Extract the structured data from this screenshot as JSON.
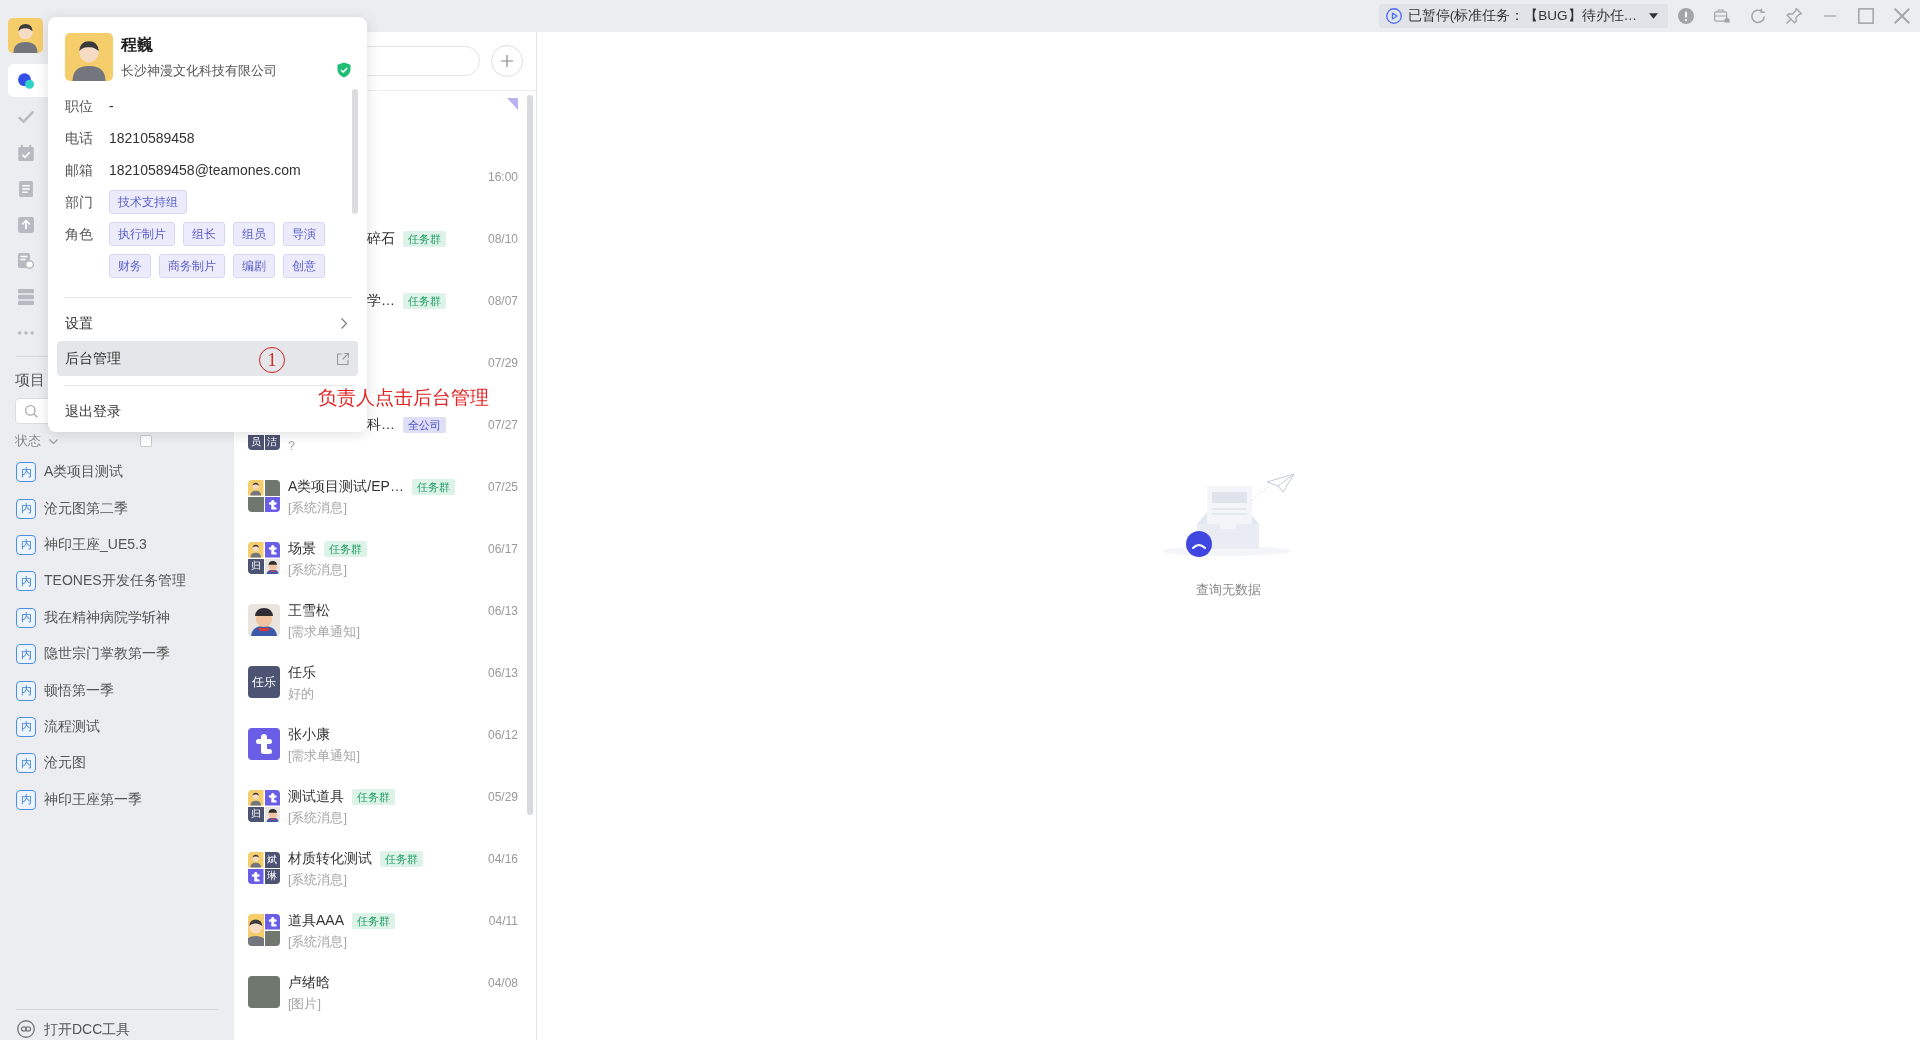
{
  "title_bar": {
    "timer": {
      "text": "已暂停(标准任务：【BUG】待办任…",
      "paused": true
    }
  },
  "sidebar": {
    "nav_items": [
      {
        "kind": "chat",
        "selected": true
      },
      {
        "kind": "check",
        "selected": false
      },
      {
        "kind": "calendar",
        "selected": false
      },
      {
        "kind": "document",
        "selected": false
      },
      {
        "kind": "upload",
        "selected": false
      },
      {
        "kind": "file",
        "selected": false
      },
      {
        "kind": "stack",
        "selected": false
      },
      {
        "kind": "more",
        "selected": false
      }
    ],
    "projects": {
      "title": "项目",
      "filter": {
        "label": "状态",
        "checked": false
      },
      "items": [
        {
          "badge": "内",
          "name": "A类项目测试"
        },
        {
          "badge": "内",
          "name": "沧元图第二季"
        },
        {
          "badge": "内",
          "name": "神印王座_UE5.3"
        },
        {
          "badge": "内",
          "name": "TEONES开发任务管理"
        },
        {
          "badge": "内",
          "name": "我在精神病院学斩神"
        },
        {
          "badge": "内",
          "name": "隐世宗门掌教第一季"
        },
        {
          "badge": "内",
          "name": "顿悟第一季"
        },
        {
          "badge": "内",
          "name": "流程测试"
        },
        {
          "badge": "内",
          "name": "沧元图"
        },
        {
          "badge": "内",
          "name": "神印王座第一季"
        }
      ]
    },
    "footer": {
      "label": "打开DCC工具"
    }
  },
  "chat_list": {
    "rows": [
      {
        "kind": "covered",
        "pinned": true
      },
      {
        "kind": "covered",
        "pinned": false,
        "time": "16:00"
      },
      {
        "kind": "covered",
        "pinned": false,
        "name": "碎石",
        "tag": {
          "text": "任务群",
          "kind": "task"
        },
        "time": "08/10"
      },
      {
        "kind": "covered",
        "pinned": false,
        "name": "学…",
        "tag": {
          "text": "任务群",
          "kind": "task"
        },
        "time": "08/07"
      },
      {
        "kind": "covered",
        "pinned": false,
        "time": "07/29"
      },
      {
        "kind": "covered",
        "pinned": false,
        "name": "科…",
        "tag": {
          "text": "全公司",
          "kind": "company"
        },
        "time": "07/27",
        "message": "?",
        "avatar": {
          "tiles": [
            {
              "kind": "covered"
            },
            {
              "kind": "covered"
            },
            {
              "kind": "text",
              "text": "员"
            },
            {
              "kind": "text",
              "text": "洁"
            }
          ]
        }
      },
      {
        "kind": "normal",
        "pinned": false,
        "name": "A类项目测试/EP…",
        "tag": {
          "text": "任务群",
          "kind": "task"
        },
        "time": "07/25",
        "message": "[系统消息]",
        "avatar": {
          "tiles": [
            {
              "kind": "person"
            },
            {
              "kind": "photo"
            },
            {
              "kind": "photo"
            },
            {
              "kind": "logo"
            }
          ]
        }
      },
      {
        "kind": "normal",
        "pinned": false,
        "name": "场景",
        "tag": {
          "text": "任务群",
          "kind": "task"
        },
        "time": "06/17",
        "message": "[系统消息]",
        "avatar": {
          "tiles": [
            {
              "kind": "person"
            },
            {
              "kind": "logo"
            },
            {
              "kind": "text",
              "text": "归"
            },
            {
              "kind": "cartoon"
            }
          ]
        }
      },
      {
        "kind": "normal",
        "pinned": false,
        "name": "王雪松",
        "time": "06/13",
        "message": "[需求单通知]",
        "avatar": {
          "tiles": [
            {
              "kind": "cartoon"
            }
          ]
        }
      },
      {
        "kind": "normal",
        "pinned": false,
        "name": "任乐",
        "time": "06/13",
        "message": "好的",
        "avatar": {
          "tiles": [
            {
              "kind": "text",
              "text": "任乐"
            }
          ]
        }
      },
      {
        "kind": "normal",
        "pinned": false,
        "name": "张小康",
        "time": "06/12",
        "message": "[需求单通知]",
        "avatar": {
          "tiles": [
            {
              "kind": "logo"
            }
          ]
        }
      },
      {
        "kind": "normal",
        "pinned": false,
        "name": "测试道具",
        "tag": {
          "text": "任务群",
          "kind": "task"
        },
        "time": "05/29",
        "message": "[系统消息]",
        "avatar": {
          "tiles": [
            {
              "kind": "person"
            },
            {
              "kind": "logo"
            },
            {
              "kind": "text",
              "text": "归"
            },
            {
              "kind": "cartoon"
            }
          ]
        }
      },
      {
        "kind": "normal",
        "pinned": false,
        "name": "材质转化测试",
        "tag": {
          "text": "任务群",
          "kind": "task"
        },
        "time": "04/16",
        "message": "[系统消息]",
        "avatar": {
          "tiles": [
            {
              "kind": "person"
            },
            {
              "kind": "text",
              "text": "斌"
            },
            {
              "kind": "logo"
            },
            {
              "kind": "text",
              "text": "琳"
            }
          ]
        }
      },
      {
        "kind": "normal",
        "pinned": false,
        "name": "道具AAA",
        "tag": {
          "text": "任务群",
          "kind": "task"
        },
        "time": "04/11",
        "message": "[系统消息]",
        "avatar": {
          "tiles": [
            {
              "kind": "person"
            },
            {
              "kind": "logo"
            },
            {
              "kind": "photo"
            }
          ]
        }
      },
      {
        "kind": "normal",
        "pinned": false,
        "name": "卢绪晗",
        "time": "04/08",
        "message": "[图片]",
        "avatar": {
          "tiles": [
            {
              "kind": "photo"
            }
          ]
        }
      }
    ]
  },
  "empty_state": {
    "text": "查询无数据"
  },
  "profile_popup": {
    "name": "程巍",
    "company": "长沙神漫文化科技有限公司",
    "verified": true,
    "fields": [
      {
        "label": "职位",
        "value": "-"
      },
      {
        "label": "电话",
        "value": "18210589458"
      },
      {
        "label": "邮箱",
        "value": "18210589458@teamones.com"
      },
      {
        "label": "部门",
        "tags": [
          "技术支持组"
        ]
      },
      {
        "label": "角色",
        "tags": [
          "执行制片",
          "组长",
          "组员",
          "导演",
          "财务",
          "商务制片",
          "编剧",
          "创意"
        ]
      }
    ],
    "menu": [
      {
        "label": "设置",
        "kind": "submenu",
        "selected": false
      },
      {
        "label": "后台管理",
        "kind": "external",
        "selected": true
      },
      {
        "label": "退出登录",
        "kind": "plain",
        "selected": false
      }
    ]
  },
  "annotation": {
    "marker": "1",
    "note": "负责人点击后台管理"
  }
}
